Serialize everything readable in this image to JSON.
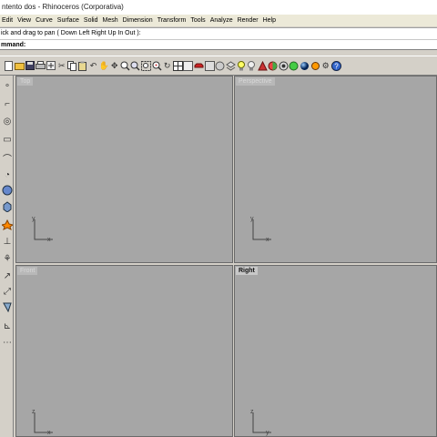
{
  "window": {
    "title": "ntento dos - Rhinoceros (Corporativa)"
  },
  "menu": {
    "items": [
      "Edit",
      "View",
      "Curve",
      "Surface",
      "Solid",
      "Mesh",
      "Dimension",
      "Transform",
      "Tools",
      "Analyze",
      "Render",
      "Help"
    ]
  },
  "command": {
    "history": "ick and drag to pan ( Down  Left  Right  Up  In  Out ):",
    "prompt_label": "mmand:",
    "input_value": ""
  },
  "toolbar": {
    "icons": [
      "new-icon",
      "open-icon",
      "save-icon",
      "print-icon",
      "import-icon",
      "cut-icon",
      "copy-icon",
      "paste-icon",
      "undo-icon",
      "pan-hand-icon",
      "rotate-view-icon",
      "zoom-dynamic-icon",
      "zoom-window-icon",
      "zoom-extents-icon",
      "zoom-selected-icon",
      "undo-view-icon",
      "four-viewports-icon",
      "viewport-properties-icon",
      "car-icon",
      "select-icon",
      "grid-icon",
      "layer-icon",
      "light-icon",
      "light-bulb-icon",
      "shade-icon",
      "render-icon",
      "render-preview-icon",
      "environment-icon",
      "sphere-icon",
      "osnap-icon",
      "options-icon",
      "help-icon"
    ]
  },
  "sidebar": {
    "tools": [
      "point-icon",
      "curve-icon",
      "circle-icon",
      "rectangle-icon",
      "polyline-icon",
      "arc-icon",
      "surface-icon",
      "solid-icon",
      "mesh-icon",
      "explode-icon",
      "dimension-icon",
      "boolean-icon",
      "curve-tools-icon",
      "transform-icon",
      "analyze-icon",
      "grid-snap-icon"
    ]
  },
  "viewports": {
    "top": {
      "label": "Top",
      "axis_x": "x",
      "axis_y": "y",
      "active": false
    },
    "perspective": {
      "label": "Perspective",
      "axis_x": "x",
      "axis_y": "y",
      "active": false
    },
    "front": {
      "label": "Front",
      "axis_x": "x",
      "axis_y": "z",
      "active": false
    },
    "right": {
      "label": "Right",
      "axis_x": "y",
      "axis_y": "z",
      "active": true
    }
  },
  "colors": {
    "viewport_background": "#a6a6a6",
    "chrome": "#d4d0c8",
    "active_label": "#101010",
    "inactive_label": "#d8d8d8"
  }
}
